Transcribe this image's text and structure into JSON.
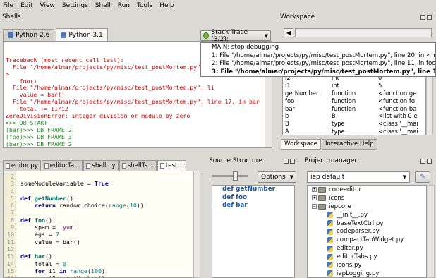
{
  "menu": [
    "File",
    "Edit",
    "View",
    "Settings",
    "Shell",
    "Run",
    "Tools",
    "Help"
  ],
  "shells": {
    "title": "Shells",
    "tabs": [
      {
        "label": "Python 2.6",
        "active": false
      },
      {
        "label": "Python 3.1",
        "active": true
      }
    ],
    "stack_button": "Stack Trace (3/2):",
    "stack_popup": [
      {
        "text": "MAIN: stop debugging",
        "current": false
      },
      {
        "text": "1: File \"/home/almar/projects/py/misc/test_postMortem.py\", line 20, in <module",
        "current": false
      },
      {
        "text": "2: File \"/home/almar/projects/py/misc/test_postMortem.py\", line 11, in foo",
        "current": false
      },
      {
        "text": "3: File \"/home/almar/projects/py/misc/test_postMortem.py\", line 17, in b",
        "current": true
      }
    ],
    "output": [
      {
        "text": "Traceback (most recent call last):",
        "style": "err"
      },
      {
        "text": "  File \"/home/almar/projects/py/misc/test_postMortem.py\", li",
        "style": "err"
      },
      {
        "text": ">",
        "style": "err"
      },
      {
        "text": "    foo()",
        "style": "err"
      },
      {
        "text": "  File \"/home/almar/projects/py/misc/test_postMortem.py\", li",
        "style": "err"
      },
      {
        "text": "    value = bar()",
        "style": "err"
      },
      {
        "text": "  File \"/home/almar/projects/py/misc/test_postMortem.py\", line 17, in bar",
        "style": "err"
      },
      {
        "text": "    total += i1/i2",
        "style": "err"
      },
      {
        "text": "ZeroDivisionError: integer division or modulo by zero",
        "style": "err"
      },
      {
        "text": ">>> DB START",
        "style": "grn"
      },
      {
        "text": "(bar)>>> DB FRAME 2",
        "style": "grn"
      },
      {
        "text": "(foo)>>> DB FRAME 3",
        "style": "grn"
      },
      {
        "text": "(bar)>>> DB FRAME 2",
        "style": "grn"
      },
      {
        "text": "(foo)>>> DB FRAME 3",
        "style": "grn"
      },
      {
        "text": "(bar)>>>",
        "style": "plain"
      }
    ]
  },
  "workspace": {
    "title": "Workspace",
    "rows": [
      [
        "i2",
        "int",
        "0"
      ],
      [
        "i1",
        "int",
        "5"
      ],
      [
        "getNumber",
        "function",
        "<function ge"
      ],
      [
        "foo",
        "function",
        "<function fo"
      ],
      [
        "bar",
        "function",
        "<function ba"
      ],
      [
        "b",
        "B",
        "<list with 0 e"
      ],
      [
        "B",
        "type",
        "<class '__mai"
      ],
      [
        "A",
        "type",
        "<class '__mai"
      ]
    ],
    "tabs": [
      {
        "label": "Workspace",
        "active": true
      },
      {
        "label": "Interactive Help",
        "active": false
      }
    ]
  },
  "editor": {
    "tabs": [
      {
        "label": "editor.py",
        "active": false
      },
      {
        "label": "editorTa...",
        "active": false
      },
      {
        "label": "shell.py",
        "active": false
      },
      {
        "label": "shellTa...",
        "active": false
      },
      {
        "label": "test...",
        "active": true
      }
    ],
    "line_numbers": [
      "2",
      "3",
      "4",
      "5",
      "6",
      "7",
      "8",
      "9",
      "10",
      "11",
      "12",
      "13",
      "14",
      "15",
      "16",
      "17"
    ],
    "lines": [
      [],
      [
        {
          "t": "someModuleVariable = "
        },
        {
          "t": "True",
          "c": "kw"
        }
      ],
      [],
      [
        {
          "t": "def ",
          "c": "kw"
        },
        {
          "t": "getNumber",
          "c": "fn"
        },
        {
          "t": "():"
        }
      ],
      [
        {
          "t": "    "
        },
        {
          "t": "return",
          "c": "kw"
        },
        {
          "t": " random.choice("
        },
        {
          "t": "range",
          "c": "bi"
        },
        {
          "t": "("
        },
        {
          "t": "10",
          "c": "num"
        },
        {
          "t": "))"
        }
      ],
      [],
      [
        {
          "t": "def ",
          "c": "kw"
        },
        {
          "t": "foo",
          "c": "fn"
        },
        {
          "t": "():"
        }
      ],
      [
        {
          "t": "    spam = "
        },
        {
          "t": "'yum'",
          "c": "str"
        }
      ],
      [
        {
          "t": "    egs = "
        },
        {
          "t": "7",
          "c": "num"
        }
      ],
      [
        {
          "t": "    value = bar()"
        }
      ],
      [],
      [
        {
          "t": "def ",
          "c": "kw"
        },
        {
          "t": "bar",
          "c": "fn"
        },
        {
          "t": "():"
        }
      ],
      [
        {
          "t": "    total = "
        },
        {
          "t": "0",
          "c": "num"
        }
      ],
      [
        {
          "t": "    "
        },
        {
          "t": "for",
          "c": "kw"
        },
        {
          "t": " i1 "
        },
        {
          "t": "in",
          "c": "kw"
        },
        {
          "t": " "
        },
        {
          "t": "range",
          "c": "bi"
        },
        {
          "t": "("
        },
        {
          "t": "100",
          "c": "num"
        },
        {
          "t": "):"
        }
      ],
      [
        {
          "t": "        i2 = getNumber()"
        }
      ],
      [
        {
          "t": "        total += i1/i2"
        }
      ]
    ]
  },
  "source_structure": {
    "title": "Source Structure",
    "options_label": "Options",
    "items": [
      "def getNumber",
      "def foo",
      "def bar"
    ]
  },
  "project_manager": {
    "title": "Project manager",
    "project": "iep default",
    "tree": [
      {
        "label": "codeeditor",
        "kind": "folder",
        "level": 0,
        "expand": "+"
      },
      {
        "label": "icons",
        "kind": "folder",
        "level": 0,
        "expand": "+"
      },
      {
        "label": "iepcore",
        "kind": "folder",
        "level": 0,
        "expand": "−"
      },
      {
        "label": "__init__.py",
        "kind": "file",
        "level": 1,
        "expand": ""
      },
      {
        "label": "baseTextCtrl.py",
        "kind": "file",
        "level": 1,
        "expand": ""
      },
      {
        "label": "codeparser.py",
        "kind": "file",
        "level": 1,
        "expand": ""
      },
      {
        "label": "compactTabWidget.py",
        "kind": "file",
        "level": 1,
        "expand": ""
      },
      {
        "label": "editor.py",
        "kind": "file",
        "level": 1,
        "expand": ""
      },
      {
        "label": "editorTabs.py",
        "kind": "file",
        "level": 1,
        "expand": ""
      },
      {
        "label": "icons.py",
        "kind": "file",
        "level": 1,
        "expand": ""
      },
      {
        "label": "iepLogging.py",
        "kind": "file",
        "level": 1,
        "expand": ""
      }
    ]
  }
}
